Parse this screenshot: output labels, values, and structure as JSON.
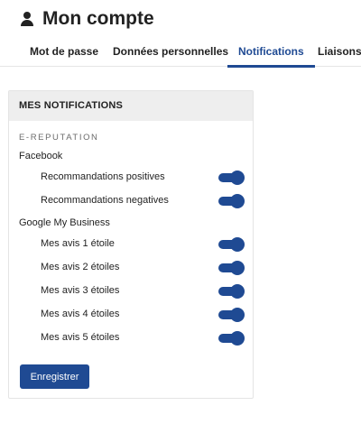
{
  "header": {
    "title": "Mon compte",
    "icon": "user-icon"
  },
  "tabs": [
    {
      "label": "Mot de passe",
      "active": false
    },
    {
      "label": "Données personnelles",
      "active": false
    },
    {
      "label": "Notifications",
      "active": true
    },
    {
      "label": "Liaisons",
      "active": false
    }
  ],
  "card": {
    "title": "MES NOTIFICATIONS",
    "section": "E-REPUTATION",
    "groups": [
      {
        "label": "Facebook",
        "items": [
          {
            "label": "Recommandations positives",
            "enabled": true
          },
          {
            "label": "Recommandations negatives",
            "enabled": true
          }
        ]
      },
      {
        "label": "Google My Business",
        "items": [
          {
            "label": "Mes avis 1 étoile",
            "enabled": true
          },
          {
            "label": "Mes avis 2 étoiles",
            "enabled": true
          },
          {
            "label": "Mes avis 3 étoiles",
            "enabled": true
          },
          {
            "label": "Mes avis 4 étoiles",
            "enabled": true
          },
          {
            "label": "Mes avis 5 étoiles",
            "enabled": true
          }
        ]
      }
    ],
    "save_label": "Enregistrer"
  },
  "colors": {
    "accent": "#1f4a93",
    "card_header_bg": "#eeeeee"
  }
}
